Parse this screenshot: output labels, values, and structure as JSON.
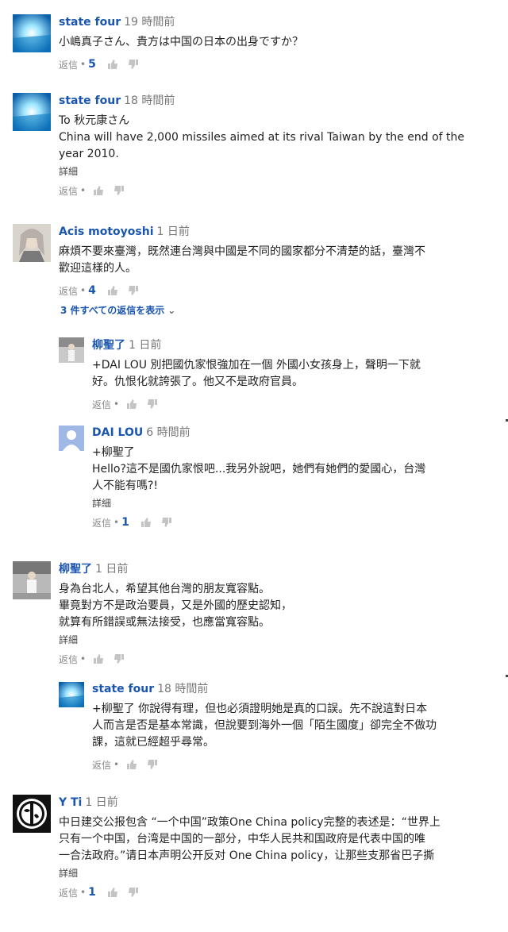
{
  "actions": {
    "reply_label": "返信",
    "dot": "•"
  },
  "more_label": "詳細",
  "view_replies": "3 件すべての返信を表示",
  "comments": [
    {
      "author": "state four",
      "time": "19 時間前",
      "lines": [
        "小嶋真子さん、貴方は中国の日本の出身ですか？"
      ],
      "likes": "5"
    },
    {
      "author": "state four",
      "time": "18 時間前",
      "lines": [
        "To 秋元康さん",
        "China will have 2,000 missiles aimed at its rival Taiwan by the end of the",
        "year 2010."
      ],
      "likes": ""
    },
    {
      "author": "Acis motoyoshi",
      "time": "1 日前",
      "lines": [
        "麻煩不要來臺灣，既然連台灣與中國是不同的國家都分不清楚的話，臺灣不",
        "歡迎這樣的人。"
      ],
      "likes": "4"
    },
    {
      "author": "柳聖了",
      "time": "1 日前",
      "lines": [
        "+DAI LOU 別把國仇家恨強加在一個 外國小女孩身上，聲明一下就",
        "好。仇恨化就誇張了。他又不是政府官員。"
      ],
      "likes": ""
    },
    {
      "author": "DAI LOU",
      "time": "6 時間前",
      "lines": [
        "+柳聖了",
        "Hello?這不是國仇家恨吧...我另外說吧，她們有她們的愛國心，台灣",
        "人不能有嗎?!"
      ],
      "likes": "1"
    },
    {
      "author": "柳聖了",
      "time": "1 日前",
      "lines": [
        "身為台北人，希望其他台灣的朋友寬容點。",
        "畢竟對方不是政治要員，又是外國的歷史認知，",
        "就算有所錯誤或無法接受，也應當寬容點。"
      ],
      "likes": ""
    },
    {
      "author": "state four",
      "time": "18 時間前",
      "lines": [
        "+柳聖了 你說得有理，但也必須證明她是真的口誤。先不說這對日本",
        "人而言是否是基本常識，但說要到海外一個「陌生國度」卻完全不做功",
        "課，這就已經超乎尋常。"
      ],
      "likes": ""
    },
    {
      "author": "Y Ti",
      "time": "1 日前",
      "lines": [
        "中日建交公报包含 “一个中国”政策One China policy完整的表述是：“世界上",
        "只有一个中国，台湾是中国的一部分，中华人民共和国政府是代表中国的唯",
        "一合法政府。”请日本声明公开反对 One China policy，让那些支那省巴子撕"
      ],
      "likes": "1"
    }
  ]
}
